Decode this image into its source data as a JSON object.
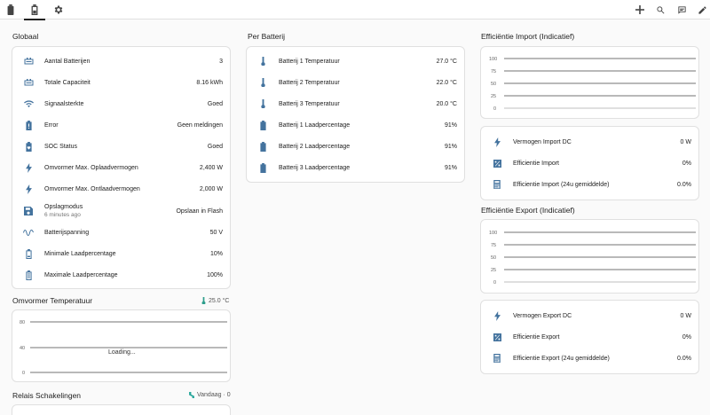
{
  "topbar": {
    "tabs": [
      {
        "name": "battery",
        "active": false
      },
      {
        "name": "battery-active",
        "active": true
      },
      {
        "name": "settings",
        "active": false
      }
    ],
    "actions": [
      "plus-icon",
      "search-icon",
      "assist-icon",
      "pencil-icon"
    ]
  },
  "globaal": {
    "title": "Globaal",
    "rows": [
      {
        "icon": "battery-bank-icon",
        "label": "Aantal Batterijen",
        "value": "3"
      },
      {
        "icon": "battery-bank-icon",
        "label": "Totale Capaciteit",
        "value": "8.16 kWh"
      },
      {
        "icon": "wifi-icon",
        "label": "Signaalsterkte",
        "value": "Goed"
      },
      {
        "icon": "battery-alert-icon",
        "label": "Error",
        "value": "Geen meldingen"
      },
      {
        "icon": "battery-heart-icon",
        "label": "SOC Status",
        "value": "Goed"
      },
      {
        "icon": "lightning-icon",
        "label": "Omvormer Max. Oplaadvermogen",
        "value": "2,400 W"
      },
      {
        "icon": "lightning-icon",
        "label": "Omvormer Max. Ontlaadvermogen",
        "value": "2,000 W"
      },
      {
        "icon": "floppy-icon",
        "label": "Opslagmodus",
        "sub": "6 minutes ago",
        "value": "Opslaan in Flash"
      },
      {
        "icon": "sine-wave-icon",
        "label": "Batterijspanning",
        "value": "50 V"
      },
      {
        "icon": "battery-low-icon",
        "label": "Minimale Laadpercentage",
        "value": "10%"
      },
      {
        "icon": "battery-full-icon",
        "label": "Maximale Laadpercentage",
        "value": "100%"
      }
    ]
  },
  "omvormer_temp": {
    "title": "Omvormer Temperatuur",
    "reading": "25.0 °C",
    "loading": "Loading...",
    "ticks": [
      "80",
      "40",
      "0"
    ]
  },
  "relais": {
    "title": "Relais Schakelingen",
    "reading": "Vandaag · 0"
  },
  "per_batterij": {
    "title": "Per Batterij",
    "rows": [
      {
        "icon": "thermometer-icon",
        "label": "Batterij 1 Temperatuur",
        "value": "27.0 °C"
      },
      {
        "icon": "thermometer-icon",
        "label": "Batterij 2 Temperatuur",
        "value": "22.0 °C"
      },
      {
        "icon": "thermometer-icon",
        "label": "Batterij 3 Temperatuur",
        "value": "20.0 °C"
      },
      {
        "icon": "battery-full-icon",
        "label": "Batterij 1 Laadpercentage",
        "value": "91%"
      },
      {
        "icon": "battery-full-icon",
        "label": "Batterij 2 Laadpercentage",
        "value": "91%"
      },
      {
        "icon": "battery-full-icon",
        "label": "Batterij 3 Laadpercentage",
        "value": "91%"
      }
    ]
  },
  "eff_import": {
    "title": "Efficiëntie Import (Indicatief)",
    "ticks": [
      "100",
      "75",
      "50",
      "25",
      "0"
    ],
    "rows": [
      {
        "icon": "lightning-icon",
        "label": "Vermogen Import DC",
        "value": "0 W"
      },
      {
        "icon": "percent-icon",
        "label": "Efficientie Import",
        "value": "0%"
      },
      {
        "icon": "calculator-icon",
        "label": "Efficientie Import (24u gemiddelde)",
        "value": "0.0%"
      }
    ]
  },
  "eff_export": {
    "title": "Efficiëntie Export (Indicatief)",
    "ticks": [
      "100",
      "75",
      "50",
      "25",
      "0"
    ],
    "rows": [
      {
        "icon": "lightning-icon",
        "label": "Vermogen Export DC",
        "value": "0 W"
      },
      {
        "icon": "percent-icon",
        "label": "Efficientie Export",
        "value": "0%"
      },
      {
        "icon": "calculator-icon",
        "label": "Efficientie Export (24u gemiddelde)",
        "value": "0.0%"
      }
    ]
  },
  "colors": {
    "accent": "#44739e",
    "temp": "#2e9e8c",
    "relay": "#26a69a"
  }
}
